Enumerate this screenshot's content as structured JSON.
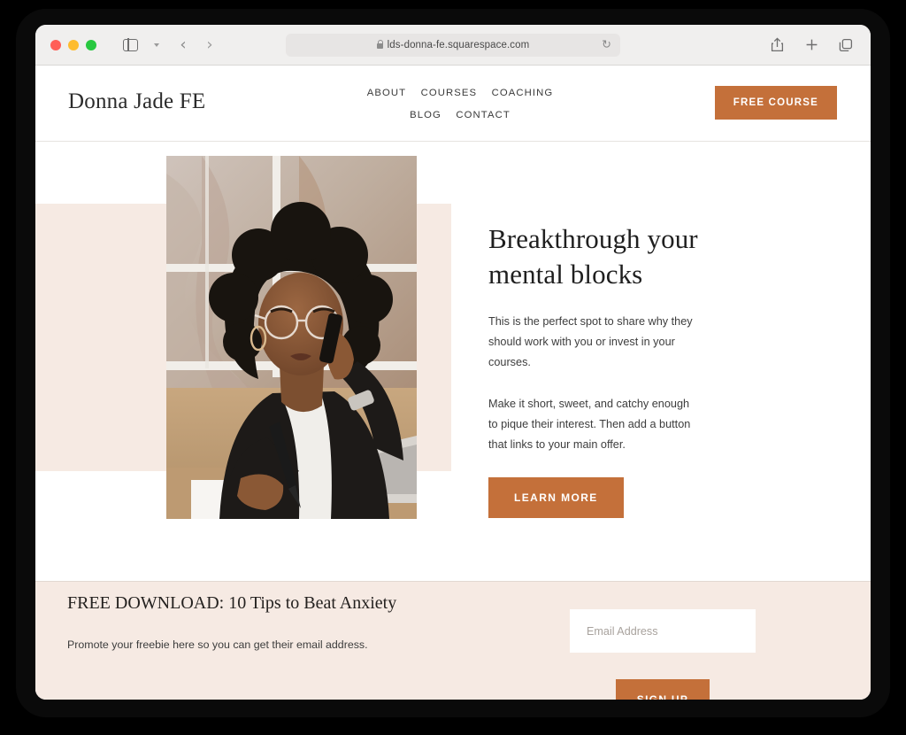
{
  "browser": {
    "url": "lds-donna-fe.squarespace.com",
    "lock_icon": "lock-icon",
    "reload_icon": "↻",
    "back_arrow": "‹",
    "forward_arrow": "›",
    "share_icon": "share-icon",
    "new_tab_icon": "plus-icon",
    "tabs_icon": "tab-overview-icon",
    "sidebar_icon": "sidebar-toggle-icon",
    "traffic_lights": [
      "close",
      "minimize",
      "zoom"
    ]
  },
  "site": {
    "logo": "Donna Jade FE",
    "nav": [
      {
        "label": "ABOUT"
      },
      {
        "label": "COURSES"
      },
      {
        "label": "COACHING"
      },
      {
        "label": "BLOG"
      },
      {
        "label": "CONTACT"
      }
    ],
    "header_cta": "FREE COURSE"
  },
  "hero": {
    "title": "Breakthrough your mental blocks",
    "paragraph1": "This is the perfect spot to share why they should work with you or invest in your courses.",
    "paragraph2": "Make it short, sweet, and catchy enough to pique their interest. Then add a button that links to your main offer.",
    "cta": "LEARN MORE",
    "image_alt": "Woman in black blazer on phone writing at desk"
  },
  "promo": {
    "title": "FREE DOWNLOAD: 10 Tips to Beat Anxiety",
    "subtitle": "Promote your freebie here so you can get their email address.",
    "email_placeholder": "Email Address",
    "email_value": "",
    "signup_label": "SIGN UP"
  },
  "colors": {
    "accent": "#c4703a",
    "beige": "#f6eae3",
    "text": "#2b2b2b",
    "chrome": "#f0efee"
  }
}
